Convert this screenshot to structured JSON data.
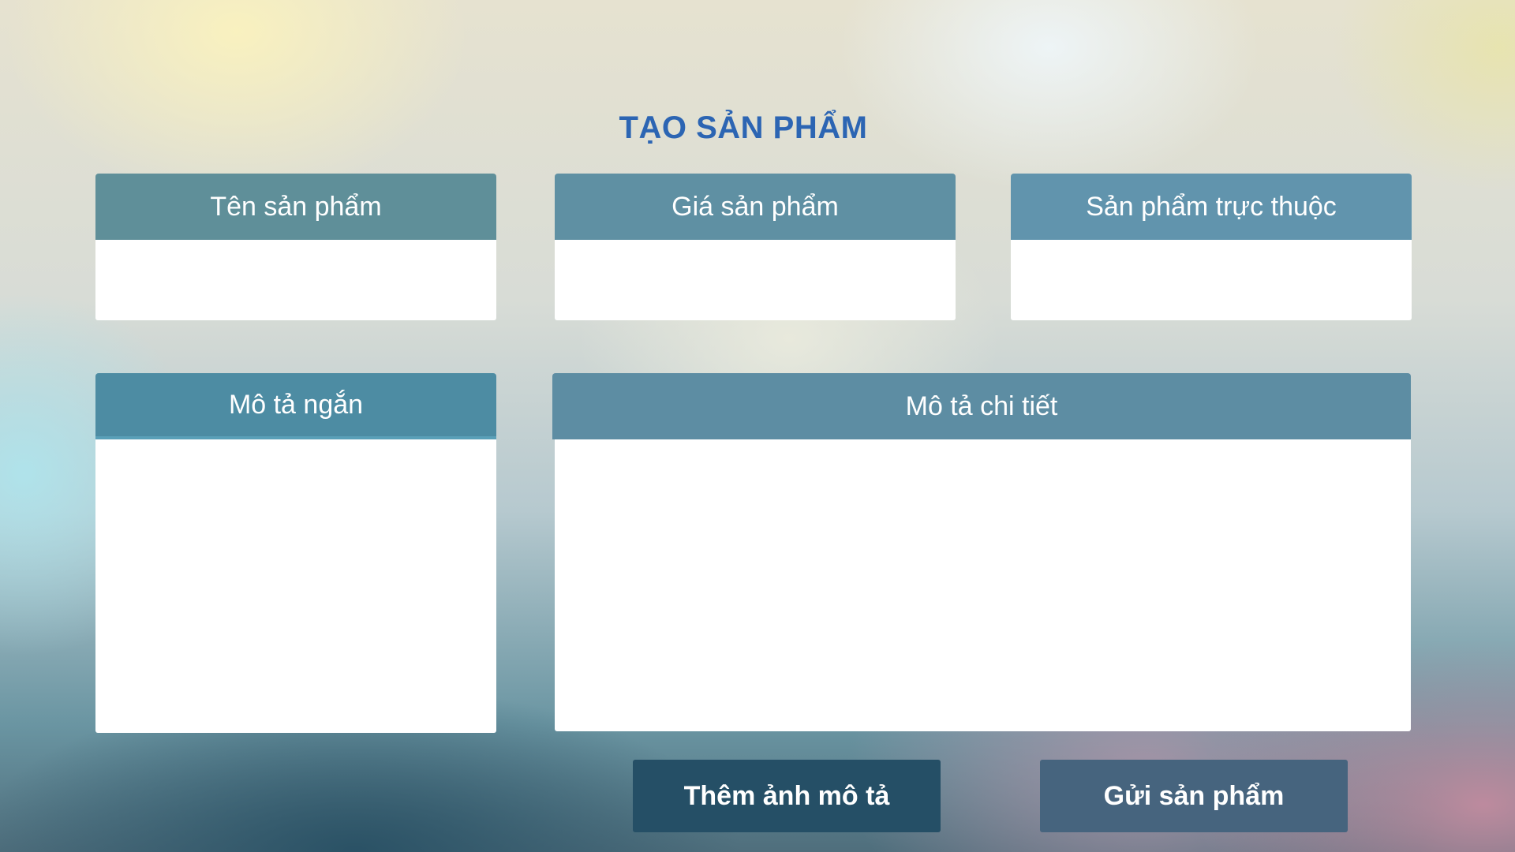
{
  "page": {
    "title": "TẠO SẢN PHẨM"
  },
  "fields": {
    "name": {
      "label": "Tên sản phẩm",
      "value": ""
    },
    "price": {
      "label": "Giá sản phẩm",
      "value": ""
    },
    "parent": {
      "label": "Sản phẩm trực thuộc",
      "value": ""
    },
    "short_description": {
      "label": "Mô tả ngắn",
      "value": ""
    },
    "detail_description": {
      "label": "Mô tả chi tiết",
      "value": ""
    }
  },
  "actions": {
    "add_image_label": "Thêm ảnh mô tả",
    "submit_label": "Gửi sản phẩm"
  }
}
